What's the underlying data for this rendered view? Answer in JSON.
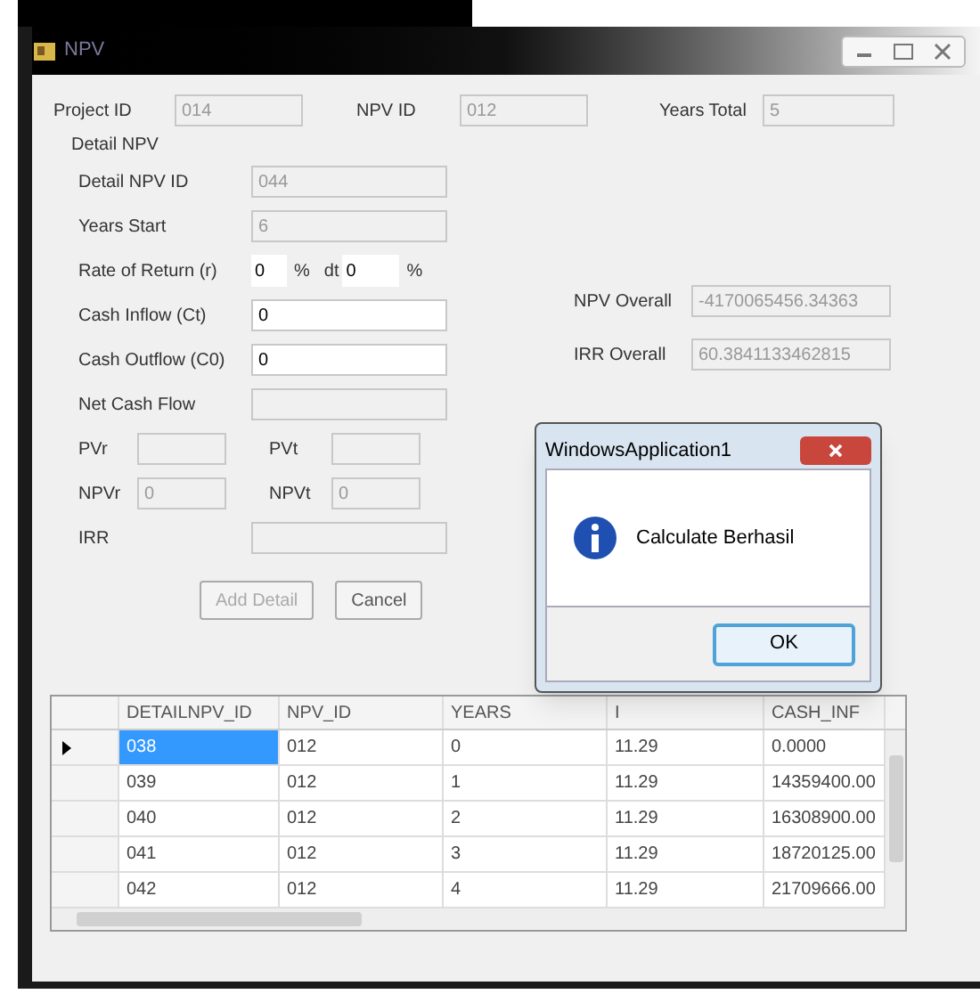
{
  "window": {
    "title": "NPV"
  },
  "header_fields": [
    {
      "label": "Project ID",
      "value": "014",
      "readonly": true
    },
    {
      "label": "NPV ID",
      "value": "012",
      "readonly": true
    },
    {
      "label": "Years Total",
      "value": "5",
      "readonly": true
    }
  ],
  "detail": {
    "title": "Detail NPV",
    "fields": [
      {
        "kind": "field",
        "label": "Detail NPV ID",
        "value": "044",
        "readonly": true
      },
      {
        "kind": "field",
        "label": "Years Start",
        "value": "6",
        "readonly": true
      },
      {
        "kind": "rate",
        "label": "Rate of Return (r)",
        "value": "0",
        "unit": "%",
        "second_label": "dt",
        "second_value": "0",
        "second_unit": "%"
      },
      {
        "kind": "field",
        "label": "Cash Inflow (Ct)",
        "value": "0",
        "readonly": false
      },
      {
        "kind": "field",
        "label": "Cash Outflow (C0)",
        "value": "0",
        "readonly": false
      },
      {
        "kind": "field",
        "label": "Net Cash Flow",
        "readonly": true
      },
      {
        "kind": "pair",
        "items": [
          {
            "label": "PVr"
          },
          {
            "label": "PVt"
          }
        ]
      },
      {
        "kind": "pair",
        "items": [
          {
            "label": "NPVr",
            "value": "0"
          },
          {
            "label": "NPVt",
            "value": "0"
          }
        ]
      },
      {
        "kind": "field",
        "label": "IRR",
        "readonly": true
      }
    ],
    "buttons": [
      {
        "label": "Add Detail",
        "disabled": true
      },
      {
        "label": "Cancel",
        "disabled": false
      }
    ]
  },
  "overall": [
    {
      "label": "NPV Overall",
      "value": "-4170065456.34363"
    },
    {
      "label": "IRR Overall",
      "value": "60.3841133462815"
    }
  ],
  "dialog": {
    "title": "WindowsApplication1",
    "message": "Calculate Berhasil",
    "button": "OK"
  },
  "grid": {
    "columns": [
      "DETAILNPV_ID",
      "NPV_ID",
      "YEARS",
      "I",
      "CASH_INF"
    ],
    "rows": [
      {
        "selected": true,
        "cells": [
          "038",
          "012",
          "0",
          "11.29",
          "0.0000"
        ]
      },
      {
        "selected": false,
        "cells": [
          "039",
          "012",
          "1",
          "11.29",
          "14359400.00"
        ]
      },
      {
        "selected": false,
        "cells": [
          "040",
          "012",
          "2",
          "11.29",
          "16308900.00"
        ]
      },
      {
        "selected": false,
        "cells": [
          "041",
          "012",
          "3",
          "11.29",
          "18720125.00"
        ]
      },
      {
        "selected": false,
        "cells": [
          "042",
          "012",
          "4",
          "11.29",
          "21709666.00"
        ]
      }
    ]
  }
}
